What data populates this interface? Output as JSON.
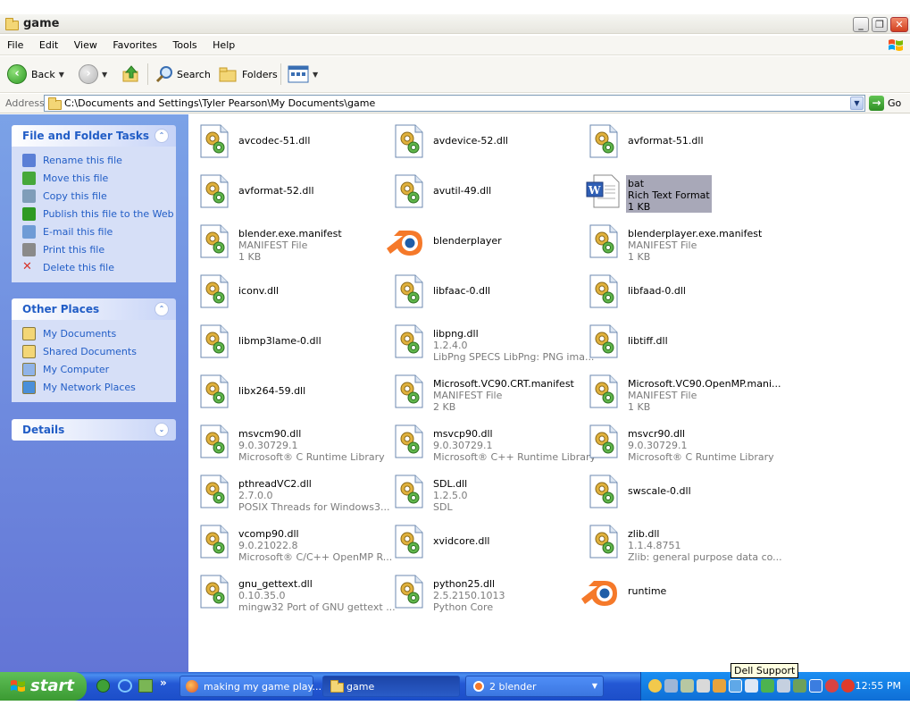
{
  "window": {
    "title": "game",
    "controls": {
      "minimize": "_",
      "maximize": "❐",
      "close": "✕"
    }
  },
  "menubar": {
    "items": [
      "File",
      "Edit",
      "View",
      "Favorites",
      "Tools",
      "Help"
    ]
  },
  "toolbar": {
    "back_label": "Back",
    "search_label": "Search",
    "folders_label": "Folders"
  },
  "address": {
    "label": "Address",
    "path": "C:\\Documents and Settings\\Tyler Pearson\\My Documents\\game",
    "go_label": "Go"
  },
  "taskpane": {
    "file_tasks": {
      "title": "File and Folder Tasks",
      "items": [
        {
          "label": "Rename this file",
          "icon": "rename-icon"
        },
        {
          "label": "Move this file",
          "icon": "move-icon"
        },
        {
          "label": "Copy this file",
          "icon": "copy-icon"
        },
        {
          "label": "Publish this file to the Web",
          "icon": "publish-web-icon"
        },
        {
          "label": "E-mail this file",
          "icon": "email-icon"
        },
        {
          "label": "Print this file",
          "icon": "print-icon"
        },
        {
          "label": "Delete this file",
          "icon": "delete-icon"
        }
      ]
    },
    "other_places": {
      "title": "Other Places",
      "items": [
        {
          "label": "My Documents",
          "icon": "my-documents-icon"
        },
        {
          "label": "Shared Documents",
          "icon": "shared-documents-icon"
        },
        {
          "label": "My Computer",
          "icon": "my-computer-icon"
        },
        {
          "label": "My Network Places",
          "icon": "network-places-icon"
        }
      ]
    },
    "details": {
      "title": "Details"
    }
  },
  "files": [
    {
      "name": "avcodec-51.dll",
      "icon": "dll-icon"
    },
    {
      "name": "avdevice-52.dll",
      "icon": "dll-icon"
    },
    {
      "name": "avformat-51.dll",
      "icon": "dll-icon"
    },
    {
      "name": "avformat-52.dll",
      "icon": "dll-icon"
    },
    {
      "name": "avutil-49.dll",
      "icon": "dll-icon"
    },
    {
      "name": "bat",
      "line2": "Rich Text Format",
      "line3": "1 KB",
      "icon": "rtf-icon",
      "selected": true
    },
    {
      "name": "blender.exe.manifest",
      "line2": "MANIFEST File",
      "line3": "1 KB",
      "icon": "dll-icon"
    },
    {
      "name": "blenderplayer",
      "icon": "blender-icon"
    },
    {
      "name": "blenderplayer.exe.manifest",
      "line2": "MANIFEST File",
      "line3": "1 KB",
      "icon": "dll-icon"
    },
    {
      "name": "iconv.dll",
      "icon": "dll-icon"
    },
    {
      "name": "libfaac-0.dll",
      "icon": "dll-icon"
    },
    {
      "name": "libfaad-0.dll",
      "icon": "dll-icon"
    },
    {
      "name": "libmp3lame-0.dll",
      "icon": "dll-icon"
    },
    {
      "name": "libpng.dll",
      "line2": "1.2.4.0",
      "line3": "LibPng SPECS LibPng: PNG ima...",
      "icon": "dll-icon"
    },
    {
      "name": "libtiff.dll",
      "icon": "dll-icon"
    },
    {
      "name": "libx264-59.dll",
      "icon": "dll-icon"
    },
    {
      "name": "Microsoft.VC90.CRT.manifest",
      "line2": "MANIFEST File",
      "line3": "2 KB",
      "icon": "dll-icon"
    },
    {
      "name": "Microsoft.VC90.OpenMP.mani...",
      "line2": "MANIFEST File",
      "line3": "1 KB",
      "icon": "dll-icon"
    },
    {
      "name": "msvcm90.dll",
      "line2": "9.0.30729.1",
      "line3": "Microsoft® C Runtime Library",
      "icon": "dll-icon"
    },
    {
      "name": "msvcp90.dll",
      "line2": "9.0.30729.1",
      "line3": "Microsoft® C++ Runtime Library",
      "icon": "dll-icon"
    },
    {
      "name": "msvcr90.dll",
      "line2": "9.0.30729.1",
      "line3": "Microsoft® C Runtime Library",
      "icon": "dll-icon"
    },
    {
      "name": "pthreadVC2.dll",
      "line2": "2.7.0.0",
      "line3": "POSIX Threads for Windows3...",
      "icon": "dll-icon"
    },
    {
      "name": "SDL.dll",
      "line2": "1.2.5.0",
      "line3": "SDL",
      "icon": "dll-icon"
    },
    {
      "name": "swscale-0.dll",
      "icon": "dll-icon"
    },
    {
      "name": "vcomp90.dll",
      "line2": "9.0.21022.8",
      "line3": "Microsoft® C/C++ OpenMP R...",
      "icon": "dll-icon"
    },
    {
      "name": "xvidcore.dll",
      "icon": "dll-icon"
    },
    {
      "name": "zlib.dll",
      "line2": "1.1.4.8751",
      "line3": "Zlib: general purpose data co...",
      "icon": "dll-icon"
    },
    {
      "name": "gnu_gettext.dll",
      "line2": "0.10.35.0",
      "line3": "mingw32 Port of GNU gettext ...",
      "icon": "dll-icon"
    },
    {
      "name": "python25.dll",
      "line2": "2.5.2150.1013",
      "line3": "Python Core",
      "icon": "dll-icon"
    },
    {
      "name": "runtime",
      "icon": "blender-icon"
    }
  ],
  "taskbar": {
    "start_label": "start",
    "quicklaunch_more": "»",
    "tasks": [
      {
        "label": "making my game play...",
        "icon": "firefox-icon"
      },
      {
        "label": "game",
        "icon": "folder-icon"
      },
      {
        "label": "2 blender",
        "icon": "blender-icon"
      }
    ],
    "clock": "12:55 PM",
    "tooltip": "Dell Support"
  }
}
